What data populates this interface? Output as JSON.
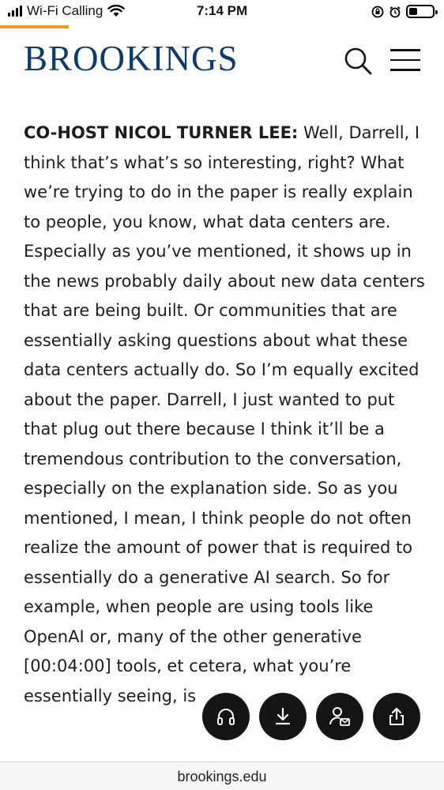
{
  "status_bar": {
    "carrier": "Wi-Fi Calling",
    "time": "7:14 PM",
    "icons": [
      "signal-icon",
      "wifi-icon",
      "rotation-lock-icon",
      "alarm-icon",
      "battery-icon"
    ],
    "battery_level": 0.45
  },
  "reading_progress": 0.155,
  "accent_color": "#f29a1e",
  "header": {
    "logo_text": "BROOKINGS",
    "logo_color": "#0e3a6c",
    "search_icon": "search-icon",
    "menu_icon": "hamburger-menu-icon"
  },
  "article": {
    "speaker": "CO-HOST NICOL TURNER LEE:",
    "text": "Well, Darrell, I think that’s what’s so interesting, right? What we’re trying to do in the paper is really explain to people, you know, what data centers are. Especially as you’ve mentioned, it shows up in the news probably daily about new data centers that are being built. Or communities that are essentially asking questions about what these data centers actually do. So I’m equally excited about the paper. Darrell, I just wanted to put that plug out there because I think it’ll be a tremendous contribution to the conversation, especially on the explanation side. So as you mentioned, I mean, I think people do not often realize the amount of power that is required to essentially do a generative AI search. So for example, when people are using tools like OpenAI or, many of the other generative [00:04:00] tools, et cetera, what you’re essentially seeing, is"
  },
  "actions": {
    "items": [
      {
        "icon": "headphones-icon"
      },
      {
        "icon": "download-icon"
      },
      {
        "icon": "contact-subscribe-icon"
      },
      {
        "icon": "share-icon"
      }
    ]
  },
  "browser": {
    "url": "brookings.edu"
  }
}
